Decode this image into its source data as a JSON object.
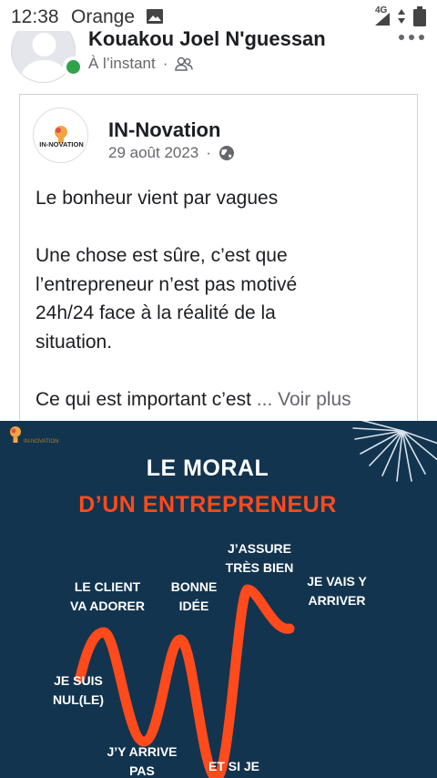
{
  "status_bar": {
    "time": "12:38",
    "carrier": "Orange",
    "network": "4G",
    "icons": [
      "image-icon",
      "signal-icon",
      "data-arrows-icon",
      "battery-icon"
    ]
  },
  "post": {
    "author": "Kouakou Joel N'guessan",
    "time": "À l’instant",
    "separator": "·",
    "audience_icon": "friends-icon",
    "more_icon": "more-horizontal-icon"
  },
  "shared": {
    "page_name": "IN-Novation",
    "logo_text": "IN-NOVATION",
    "date": "29 août 2023",
    "separator": "·",
    "audience_icon": "globe-icon",
    "text": {
      "line1": "Le bonheur vient par vagues",
      "line2": "Une chose est sûre, c’est que",
      "line3": "l’entrepreneur n’est pas motivé",
      "line4": "24h/24 face à la réalité de la",
      "line5": "situation.",
      "line6": "Ce qui est important c’est",
      "see_more": "... Voir plus"
    }
  },
  "image": {
    "logo_text": "IN-NOVATION",
    "title_line1": "LE MORAL",
    "title_line2": "D’UN ENTREPRENEUR",
    "labels": {
      "client_1": "LE CLIENT",
      "client_2": "VA ADORER",
      "bonne_1": "BONNE",
      "bonne_2": "IDÉE",
      "assure_1": "J’ASSURE",
      "assure_2": "TRÈS BIEN",
      "vais_1": "JE VAIS Y",
      "vais_2": "ARRIVER",
      "nul_1": "JE SUIS",
      "nul_2": "NUL(LE)",
      "arrive_1": "J’Y ARRIVE",
      "arrive_2": "PAS",
      "etsi": "ET SI JE"
    },
    "colors": {
      "background": "#12344f",
      "accent": "#ff4a1c",
      "text": "#ffffff"
    }
  }
}
